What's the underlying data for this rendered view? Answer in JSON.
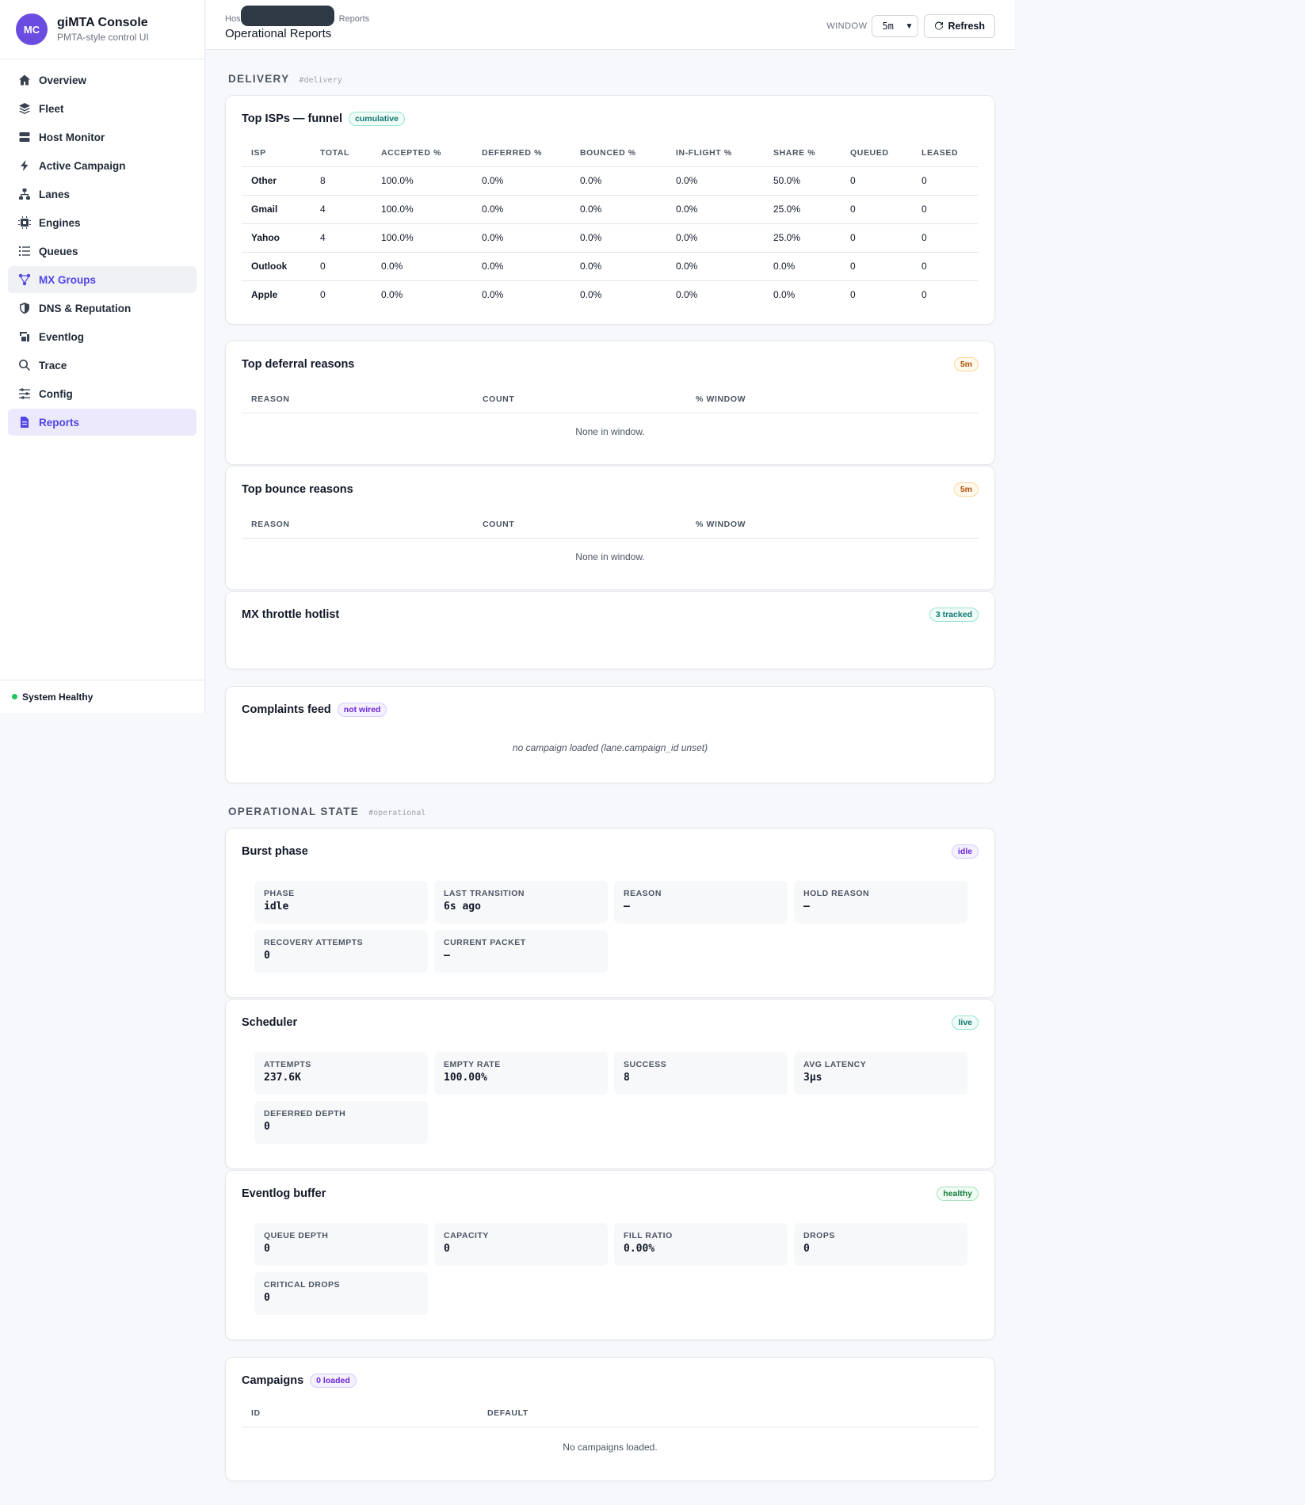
{
  "app": {
    "initials": "MC",
    "title": "giMTA Console",
    "subtitle": "PMTA-style control UI"
  },
  "nav": [
    {
      "label": "Overview",
      "icon": "home-icon"
    },
    {
      "label": "Fleet",
      "icon": "layers-icon"
    },
    {
      "label": "Host Monitor",
      "icon": "server-icon"
    },
    {
      "label": "Active Campaign",
      "icon": "bolt-icon"
    },
    {
      "label": "Lanes",
      "icon": "lanes-icon"
    },
    {
      "label": "Engines",
      "icon": "cpu-icon"
    },
    {
      "label": "Queues",
      "icon": "list-icon"
    },
    {
      "label": "MX Groups",
      "icon": "share-icon"
    },
    {
      "label": "DNS & Reputation",
      "icon": "shield-icon"
    },
    {
      "label": "Eventlog",
      "icon": "log-icon"
    },
    {
      "label": "Trace",
      "icon": "search-icon"
    },
    {
      "label": "Config",
      "icon": "sliders-icon"
    },
    {
      "label": "Reports",
      "icon": "document-icon"
    }
  ],
  "status": {
    "label": "System Healthy",
    "color": "#22c55e"
  },
  "header": {
    "breadcrumb_first": "Hos",
    "breadcrumb_last": "Reports",
    "title": "Operational Reports",
    "window_label": "WINDOW",
    "window_value": "5m",
    "refresh_label": "Refresh"
  },
  "delivery": {
    "heading": "DELIVERY",
    "anchor": "#delivery",
    "isp_funnel": {
      "title": "Top ISPs — funnel",
      "badge": "cumulative",
      "columns": [
        "ISP",
        "TOTAL",
        "ACCEPTED %",
        "DEFERRED %",
        "BOUNCED %",
        "IN-FLIGHT %",
        "SHARE %",
        "QUEUED",
        "LEASED"
      ],
      "rows": [
        [
          "Other",
          "8",
          "100.0%",
          "0.0%",
          "0.0%",
          "0.0%",
          "50.0%",
          "0",
          "0"
        ],
        [
          "Gmail",
          "4",
          "100.0%",
          "0.0%",
          "0.0%",
          "0.0%",
          "25.0%",
          "0",
          "0"
        ],
        [
          "Yahoo",
          "4",
          "100.0%",
          "0.0%",
          "0.0%",
          "0.0%",
          "25.0%",
          "0",
          "0"
        ],
        [
          "Outlook",
          "0",
          "0.0%",
          "0.0%",
          "0.0%",
          "0.0%",
          "0.0%",
          "0",
          "0"
        ],
        [
          "Apple",
          "0",
          "0.0%",
          "0.0%",
          "0.0%",
          "0.0%",
          "0.0%",
          "0",
          "0"
        ]
      ]
    },
    "deferrals": {
      "title": "Top deferral reasons",
      "badge": "5m",
      "columns": [
        "REASON",
        "COUNT",
        "% WINDOW"
      ],
      "empty": "None in window."
    },
    "bounces": {
      "title": "Top bounce reasons",
      "badge": "5m",
      "columns": [
        "REASON",
        "COUNT",
        "% WINDOW"
      ],
      "empty": "None in window."
    },
    "mx_hotlist": {
      "title": "MX throttle hotlist",
      "badge": "3 tracked"
    },
    "complaints": {
      "title": "Complaints feed",
      "badge": "not wired",
      "empty": "no campaign loaded (lane.campaign_id unset)"
    }
  },
  "operational": {
    "heading": "OPERATIONAL STATE",
    "anchor": "#operational",
    "burst": {
      "title": "Burst phase",
      "badge": "idle",
      "stats": [
        {
          "label": "PHASE",
          "value": "idle"
        },
        {
          "label": "LAST TRANSITION",
          "value": "6s ago"
        },
        {
          "label": "REASON",
          "value": "—"
        },
        {
          "label": "HOLD REASON",
          "value": "—"
        },
        {
          "label": "RECOVERY ATTEMPTS",
          "value": "0"
        },
        {
          "label": "CURRENT PACKET",
          "value": "—"
        }
      ]
    },
    "scheduler": {
      "title": "Scheduler",
      "badge": "live",
      "stats": [
        {
          "label": "ATTEMPTS",
          "value": "237.6K"
        },
        {
          "label": "EMPTY RATE",
          "value": "100.00%"
        },
        {
          "label": "SUCCESS",
          "value": "8"
        },
        {
          "label": "AVG LATENCY",
          "value": "3µs"
        },
        {
          "label": "DEFERRED DEPTH",
          "value": "0"
        }
      ]
    },
    "eventlog": {
      "title": "Eventlog buffer",
      "badge": "healthy",
      "stats": [
        {
          "label": "QUEUE DEPTH",
          "value": "0"
        },
        {
          "label": "CAPACITY",
          "value": "0"
        },
        {
          "label": "FILL RATIO",
          "value": "0.00%"
        },
        {
          "label": "DROPS",
          "value": "0"
        },
        {
          "label": "CRITICAL DROPS",
          "value": "0"
        }
      ]
    },
    "campaigns": {
      "title": "Campaigns",
      "badge": "0 loaded",
      "columns": [
        "ID",
        "DEFAULT"
      ],
      "empty": "No campaigns loaded."
    }
  }
}
